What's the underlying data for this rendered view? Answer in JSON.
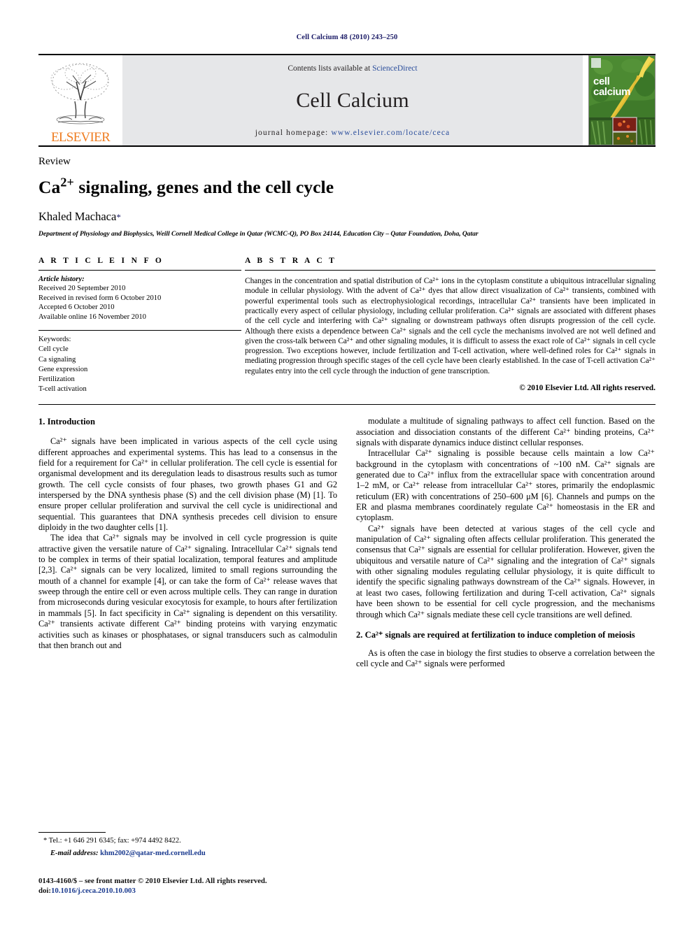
{
  "running_head": "Cell Calcium 48 (2010) 243–250",
  "masthead": {
    "publisher": "ELSEVIER",
    "contents_prefix": "Contents lists available at ",
    "contents_link": "ScienceDirect",
    "journal_title": "Cell Calcium",
    "homepage_prefix": "journal homepage: ",
    "homepage_url": "www.elsevier.com/locate/ceca",
    "cover_line1": "cell",
    "cover_line2": "calcium",
    "accent_orange": "#ef7d22",
    "link_blue": "#2a4d9b",
    "masthead_bg": "#e6e7e9"
  },
  "article": {
    "type": "Review",
    "title_prefix": "Ca",
    "title_sup": "2+",
    "title_rest": " signaling, genes and the cell cycle",
    "author": "Khaled Machaca",
    "author_marker": "*",
    "affiliation": "Department of Physiology and Biophysics, Weill Cornell Medical College in Qatar (WCMC-Q), PO Box 24144, Education City – Qatar Foundation, Doha, Qatar"
  },
  "article_info": {
    "heading": "A R T I C L E    I N F O",
    "history_label": "Article history:",
    "history": [
      "Received 20 September 2010",
      "Received in revised form 6 October 2010",
      "Accepted 6 October 2010",
      "Available online 16 November 2010"
    ],
    "keywords_label": "Keywords:",
    "keywords": [
      "Cell cycle",
      "Ca signaling",
      "Gene expression",
      "Fertilization",
      "T-cell activation"
    ]
  },
  "abstract": {
    "heading": "A B S T R A C T",
    "text": "Changes in the concentration and spatial distribution of Ca²⁺ ions in the cytoplasm constitute a ubiquitous intracellular signaling module in cellular physiology. With the advent of Ca²⁺ dyes that allow direct visualization of Ca²⁺ transients, combined with powerful experimental tools such as electrophysiological recordings, intracellular Ca²⁺ transients have been implicated in practically every aspect of cellular physiology, including cellular proliferation. Ca²⁺ signals are associated with different phases of the cell cycle and interfering with Ca²⁺ signaling or downstream pathways often disrupts progression of the cell cycle. Although there exists a dependence between Ca²⁺ signals and the cell cycle the mechanisms involved are not well defined and given the cross-talk between Ca²⁺ and other signaling modules, it is difficult to assess the exact role of Ca²⁺ signals in cell cycle progression. Two exceptions however, include fertilization and T-cell activation, where well-defined roles for Ca²⁺ signals in mediating progression through specific stages of the cell cycle have been clearly established. In the case of T-cell activation Ca²⁺ regulates entry into the cell cycle through the induction of gene transcription.",
    "copyright": "© 2010 Elsevier Ltd. All rights reserved."
  },
  "sections": {
    "intro_heading": "1.  Introduction",
    "intro_p1": "Ca²⁺ signals have been implicated in various aspects of the cell cycle using different approaches and experimental systems. This has lead to a consensus in the field for a requirement for Ca²⁺ in cellular proliferation. The cell cycle is essential for organismal development and its deregulation leads to disastrous results such as tumor growth. The cell cycle consists of four phases, two growth phases G1 and G2 interspersed by the DNA synthesis phase (S) and the cell division phase (M) [1]. To ensure proper cellular proliferation and survival the cell cycle is unidirectional and sequential. This guarantees that DNA synthesis precedes cell division to ensure diploidy in the two daughter cells [1].",
    "intro_p2": "The idea that Ca²⁺ signals may be involved in cell cycle progression is quite attractive given the versatile nature of Ca²⁺ signaling. Intracellular Ca²⁺ signals tend to be complex in terms of their spatial localization, temporal features and amplitude [2,3]. Ca²⁺ signals can be very localized, limited to small regions surrounding the mouth of a channel for example [4], or can take the form of Ca²⁺ release waves that sweep through the entire cell or even across multiple cells. They can range in duration from microseconds during vesicular exocytosis for example, to hours after fertilization in mammals [5]. In fact specificity in Ca²⁺ signaling is dependent on this versatility. Ca²⁺ transients activate different Ca²⁺ binding proteins with varying enzymatic activities such as kinases or phosphatases, or signal transducers such as calmodulin that then branch out and",
    "right_p1": "modulate a multitude of signaling pathways to affect cell function. Based on the association and dissociation constants of the different Ca²⁺ binding proteins, Ca²⁺ signals with disparate dynamics induce distinct cellular responses.",
    "right_p2": "Intracellular Ca²⁺ signaling is possible because cells maintain a low Ca²⁺ background in the cytoplasm with concentrations of ~100 nM. Ca²⁺ signals are generated due to Ca²⁺ influx from the extracellular space with concentration around 1–2 mM, or Ca²⁺ release from intracellular Ca²⁺ stores, primarily the endoplasmic reticulum (ER) with concentrations of 250–600 μM [6]. Channels and pumps on the ER and plasma membranes coordinately regulate Ca²⁺ homeostasis in the ER and cytoplasm.",
    "right_p3": "Ca²⁺ signals have been detected at various stages of the cell cycle and manipulation of Ca²⁺ signaling often affects cellular proliferation. This generated the consensus that Ca²⁺ signals are essential for cellular proliferation. However, given the ubiquitous and versatile nature of Ca²⁺ signaling and the integration of Ca²⁺ signals with other signaling modules regulating cellular physiology, it is quite difficult to identify the specific signaling pathways downstream of the Ca²⁺ signals. However, in at least two cases, following fertilization and during T-cell activation, Ca²⁺ signals have been shown to be essential for cell cycle progression, and the mechanisms through which Ca²⁺ signals mediate these cell cycle transitions are well defined.",
    "sec2_heading": "2.  Ca²⁺ signals are required at fertilization to induce completion of meiosis",
    "sec2_p1": "As is often the case in biology the first studies to observe a correlation between the cell cycle and Ca²⁺ signals were performed"
  },
  "footnotes": {
    "corresponding": "* Tel.: +1 646 291 6345; fax: +974 4492 8422.",
    "email_label": "E-mail address:",
    "email": "khm2002@qatar-med.cornell.edu",
    "issn_line": "0143-4160/$ – see front matter © 2010 Elsevier Ltd. All rights reserved.",
    "doi_label": "doi:",
    "doi": "10.1016/j.ceca.2010.10.003"
  }
}
